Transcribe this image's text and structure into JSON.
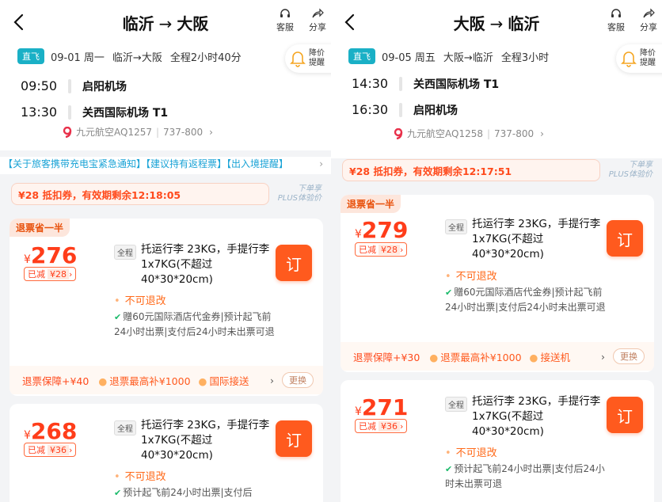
{
  "header": {
    "service_label": "客服",
    "share_label": "分享",
    "alert_line1": "降价",
    "alert_line2": "提醒"
  },
  "panels": [
    {
      "title_from": "临沂",
      "title_arrow": "→",
      "title_to": "大阪",
      "tag": "直飞",
      "date": "09-01 周一",
      "route": "临沂→大阪",
      "duration": "全程2小时40分",
      "depart_time": "09:50",
      "depart_airport": "启阳机场",
      "arrive_time": "13:30",
      "arrive_airport": "关西国际机场 T1",
      "airline": "九元航空AQ1257",
      "aircraft": "737-800",
      "notice": "【关于旅客携带充电宝紧急通知】【建议持有返程票】【出入境提醒】",
      "coupon": "¥28 抵扣券，有效期剩余12:18:05",
      "plus_line1": "下单享",
      "plus_line2": "PLUS体验价",
      "cards": [
        {
          "badge": "退票省一半",
          "currency": "¥",
          "price": "276",
          "reduced_label": "已减",
          "reduced_amount": "¥28",
          "quanch": "全程",
          "bag": "托运行李 23KG，手提行李 1x7KG(不超过40*30*20cm)",
          "order": "订",
          "norefund": "不可退改",
          "gift": "赠60元国际酒店代金券|预计起飞前24小时出票|支付后24小时未出票可退",
          "guarantee_label": "退票保障+¥40",
          "guarantee_item1": "退票最高补¥1000",
          "guarantee_item2": "国际接送",
          "change": "更换"
        },
        {
          "currency": "¥",
          "price": "268",
          "reduced_label": "已减",
          "reduced_amount": "¥36",
          "quanch": "全程",
          "bag": "托运行李 23KG，手提行李 1x7KG(不超过40*30*20cm)",
          "order": "订",
          "norefund": "不可退改",
          "gift": "预计起飞前24小时出票|支付后"
        }
      ]
    },
    {
      "title_from": "大阪",
      "title_arrow": "→",
      "title_to": "临沂",
      "tag": "直飞",
      "date": "09-05 周五",
      "route": "大阪→临沂",
      "duration": "全程3小时",
      "depart_time": "14:30",
      "depart_airport": "关西国际机场 T1",
      "arrive_time": "16:30",
      "arrive_airport": "启阳机场",
      "airline": "九元航空AQ1258",
      "aircraft": "737-800",
      "coupon": "¥28 抵扣券，有效期剩余12:17:51",
      "plus_line1": "下单享",
      "plus_line2": "PLUS体验价",
      "cards": [
        {
          "badge": "退票省一半",
          "currency": "¥",
          "price": "279",
          "reduced_label": "已减",
          "reduced_amount": "¥28",
          "quanch": "全程",
          "bag": "托运行李 23KG，手提行李 1x7KG(不超过40*30*20cm)",
          "order": "订",
          "norefund": "不可退改",
          "gift": "赠60元国际酒店代金券|预计起飞前24小时出票|支付后24小时未出票可退",
          "guarantee_label": "退票保障+¥30",
          "guarantee_item1": "退票最高补¥1000",
          "guarantee_item2": "接送机",
          "change": "更换"
        },
        {
          "currency": "¥",
          "price": "271",
          "reduced_label": "已减",
          "reduced_amount": "¥36",
          "quanch": "全程",
          "bag": "托运行李 23KG，手提行李 1x7KG(不超过40*30*20cm)",
          "order": "订",
          "norefund": "不可退改",
          "gift": "预计起飞前24小时出票|支付后24小时未出票可退"
        }
      ]
    }
  ]
}
